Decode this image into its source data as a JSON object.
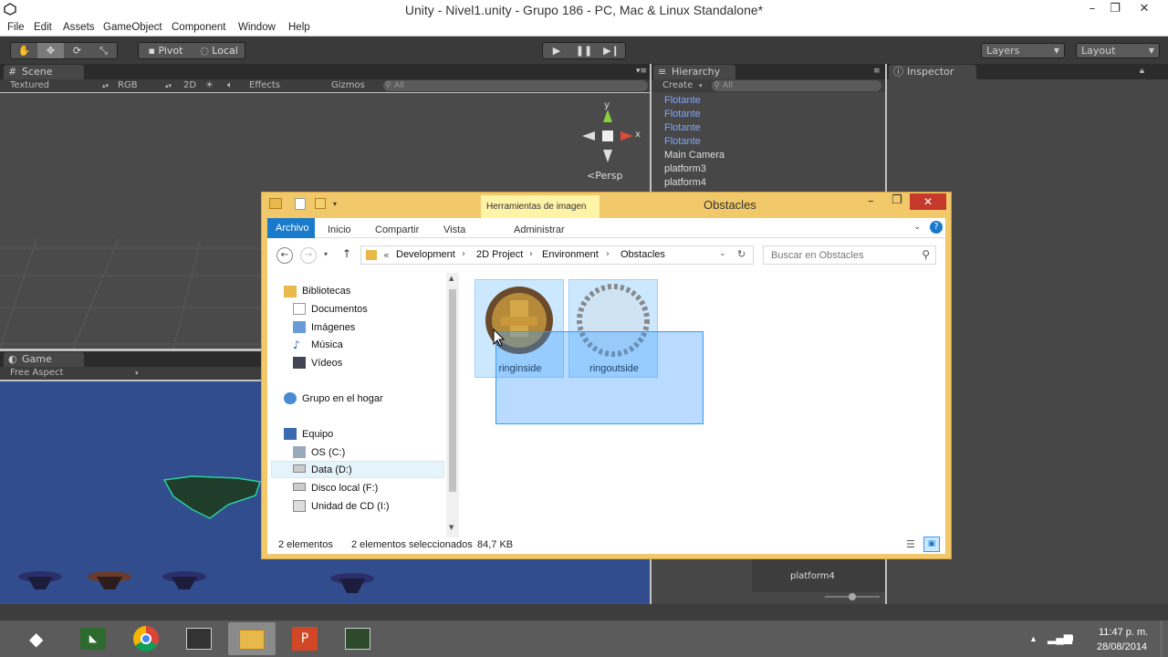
{
  "window": {
    "title": "Unity - Nivel1.unity - Grupo 186 - PC, Mac & Linux Standalone*"
  },
  "menu": [
    "File",
    "Edit",
    "Assets",
    "GameObject",
    "Component",
    "Window",
    "Help"
  ],
  "toolbar": {
    "pivot": "Pivot",
    "local": "Local",
    "layers": "Layers",
    "layout": "Layout"
  },
  "scene": {
    "tab": "Scene",
    "shading": "Textured",
    "render_mode": "RGB",
    "mode_2d": "2D",
    "effects": "Effects",
    "gizmos": "Gizmos",
    "search": "All",
    "gizmo_y": "y",
    "gizmo_x": "x",
    "persp": "Persp"
  },
  "game": {
    "tab": "Game",
    "aspect": "Free Aspect"
  },
  "hierarchy": {
    "tab": "Hierarchy",
    "create": "Create",
    "search": "All",
    "items": [
      {
        "label": "Flotante",
        "prefab": true
      },
      {
        "label": "Flotante",
        "prefab": true
      },
      {
        "label": "Flotante",
        "prefab": true
      },
      {
        "label": "Flotante",
        "prefab": true
      },
      {
        "label": "Main Camera",
        "prefab": false
      },
      {
        "label": "platform3",
        "prefab": false
      },
      {
        "label": "platform4",
        "prefab": false
      }
    ]
  },
  "inspector": {
    "tab": "Inspector"
  },
  "project": {
    "selected_label": "platform4"
  },
  "explorer": {
    "title": "Obstacles",
    "contextual_tab": "Herramientas de imagen",
    "tabs": [
      "Archivo",
      "Inicio",
      "Compartir",
      "Vista",
      "Administrar"
    ],
    "breadcrumb": [
      "Development",
      "2D Project",
      "Environment",
      "Obstacles"
    ],
    "search_placeholder": "Buscar en Obstacles",
    "nav": {
      "libraries": "Bibliotecas",
      "documents": "Documentos",
      "images": "Imágenes",
      "music": "Música",
      "videos": "Vídeos",
      "homegroup": "Grupo en el hogar",
      "computer": "Equipo",
      "drive_c": "OS (C:)",
      "drive_d": "Data (D:)",
      "drive_f": "Disco local (F:)",
      "drive_cd": "Unidad de CD (I:)"
    },
    "files": [
      {
        "name": "ringinside"
      },
      {
        "name": "ringoutside"
      }
    ],
    "status": {
      "count": "2 elementos",
      "selected": "2 elementos seleccionados",
      "size": "84,7 KB"
    }
  },
  "taskbar": {
    "time": "11:47 p. m.",
    "date": "28/08/2014"
  },
  "colors": {
    "prefab_text": "#7fa5ff",
    "selection": "#cce8ff",
    "game_bg": "#314d8d"
  }
}
